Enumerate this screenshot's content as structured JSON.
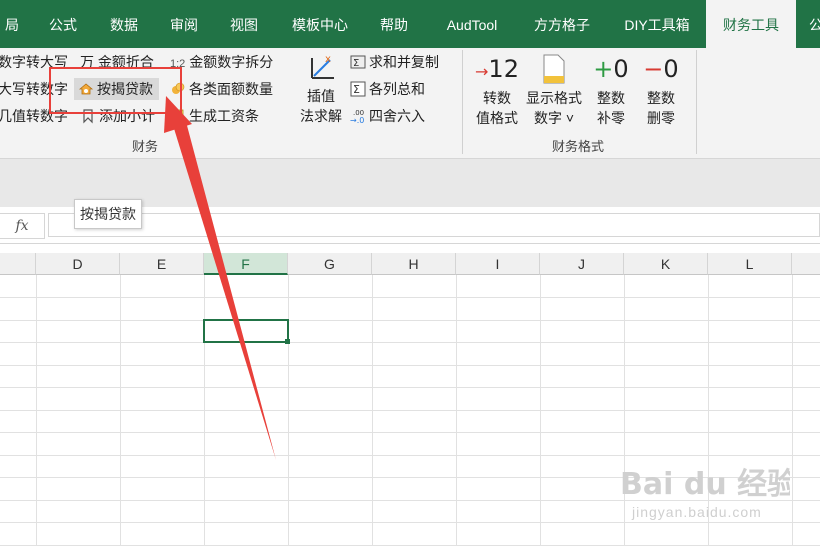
{
  "tabs": [
    {
      "label": "局",
      "active": false
    },
    {
      "label": "公式",
      "active": false
    },
    {
      "label": "数据",
      "active": false
    },
    {
      "label": "审阅",
      "active": false
    },
    {
      "label": "视图",
      "active": false
    },
    {
      "label": "模板中心",
      "active": false
    },
    {
      "label": "帮助",
      "active": false
    },
    {
      "label": "AudTool",
      "active": false
    },
    {
      "label": "方方格子",
      "active": false
    },
    {
      "label": "DIY工具箱",
      "active": false
    },
    {
      "label": "财务工具",
      "active": true
    },
    {
      "label": "公",
      "active": false
    }
  ],
  "ribbon": {
    "finance_group": {
      "label": "财务",
      "items": {
        "num_to_upper": "数字转大写",
        "upper_to_num": "大写转数字",
        "value_to_num": "几值转数字",
        "wan_rounding": "万 金额折合",
        "loan_by_mortgage": "按揭贷款",
        "add_subtotal": "添加小计",
        "amount_split": "金额数字拆分",
        "denomination_count": "各类面额数量",
        "generate_salary": "生成工资条",
        "interp_line1": "插值",
        "interp_line2": "法求解",
        "sum_copy": "求和并复制",
        "column_total": "各列总和",
        "round_half": "四舍六入"
      }
    },
    "format_group": {
      "label": "财务格式",
      "buttons": [
        {
          "icon": "→12",
          "line1": "转数",
          "line2": "值格式"
        },
        {
          "icon": "doc",
          "line1": "显示格式",
          "line2": "数字 ˅"
        },
        {
          "icon": "+0",
          "line1": "整数",
          "line2": "补零"
        },
        {
          "icon": "−0",
          "line1": "整数",
          "line2": "删零"
        }
      ]
    }
  },
  "formula_bar": {
    "fx": "fx"
  },
  "tooltip": "按揭贷款",
  "columns": [
    "D",
    "E",
    "F",
    "G",
    "H",
    "I",
    "J",
    "K",
    "L"
  ],
  "selected_column": "F",
  "watermark": {
    "logo": "Bai du 经验",
    "url": "jingyan.baidu.com"
  },
  "colors": {
    "accent": "#217346",
    "highlight": "#e8403a"
  }
}
